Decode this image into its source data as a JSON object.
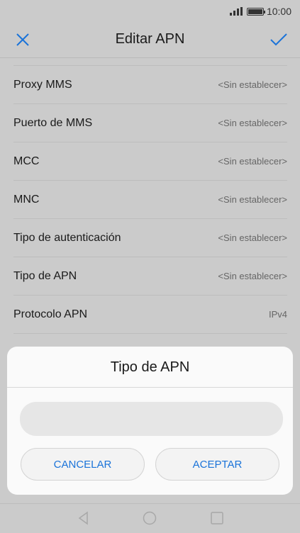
{
  "status_bar": {
    "time": "10:00"
  },
  "header": {
    "title": "Editar APN"
  },
  "settings": [
    {
      "label": "Proxy MMS",
      "value": "<Sin establecer>"
    },
    {
      "label": "Puerto de MMS",
      "value": "<Sin establecer>"
    },
    {
      "label": "MCC",
      "value": "<Sin establecer>"
    },
    {
      "label": "MNC",
      "value": "<Sin establecer>"
    },
    {
      "label": "Tipo de autenticación",
      "value": "<Sin establecer>"
    },
    {
      "label": "Tipo de APN",
      "value": "<Sin establecer>"
    },
    {
      "label": "Protocolo APN",
      "value": "IPv4"
    }
  ],
  "dialog": {
    "title": "Tipo de APN",
    "input_value": "",
    "cancel_label": "CANCELAR",
    "accept_label": "ACEPTAR"
  },
  "colors": {
    "accent": "#1a73d9",
    "scrim": "#cbcbcb",
    "dialog_bg": "#fafafa"
  },
  "icons": {
    "close": "close-icon",
    "confirm": "check-icon",
    "back": "back-triangle-icon",
    "home": "home-circle-icon",
    "recent": "recent-square-icon"
  }
}
